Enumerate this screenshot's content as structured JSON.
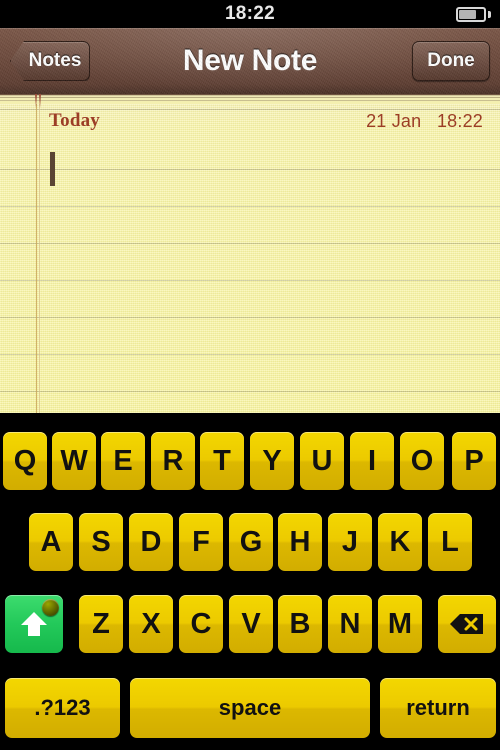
{
  "status_bar": {
    "time": "18:22",
    "battery_icon": "battery-icon",
    "battery_level_percent": 65
  },
  "nav_bar": {
    "back_label": "Notes",
    "title": "New Note",
    "done_label": "Done"
  },
  "note": {
    "day_label": "Today",
    "date": "21 Jan",
    "time": "18:22",
    "date_time": "21 Jan   18:22",
    "body_text": "",
    "caret_visible": true
  },
  "keyboard": {
    "row1": [
      "Q",
      "W",
      "E",
      "R",
      "T",
      "Y",
      "U",
      "I",
      "O",
      "P"
    ],
    "row2": [
      "A",
      "S",
      "D",
      "F",
      "G",
      "H",
      "J",
      "K",
      "L"
    ],
    "row3": [
      "Z",
      "X",
      "C",
      "V",
      "B",
      "N",
      "M"
    ],
    "shift_icon": "shift-arrow-icon",
    "shift_state": "caps-lock-on",
    "backspace_icon": "backspace-icon",
    "numbers_label": ".?123",
    "space_label": "space",
    "return_label": "return"
  },
  "colors": {
    "key_yellow": "#ecca00",
    "shift_green": "#23c95a",
    "paper_yellow": "#f7f3a8",
    "nav_brown": "#6d4a3c",
    "note_text_brown": "#9c3d26"
  }
}
